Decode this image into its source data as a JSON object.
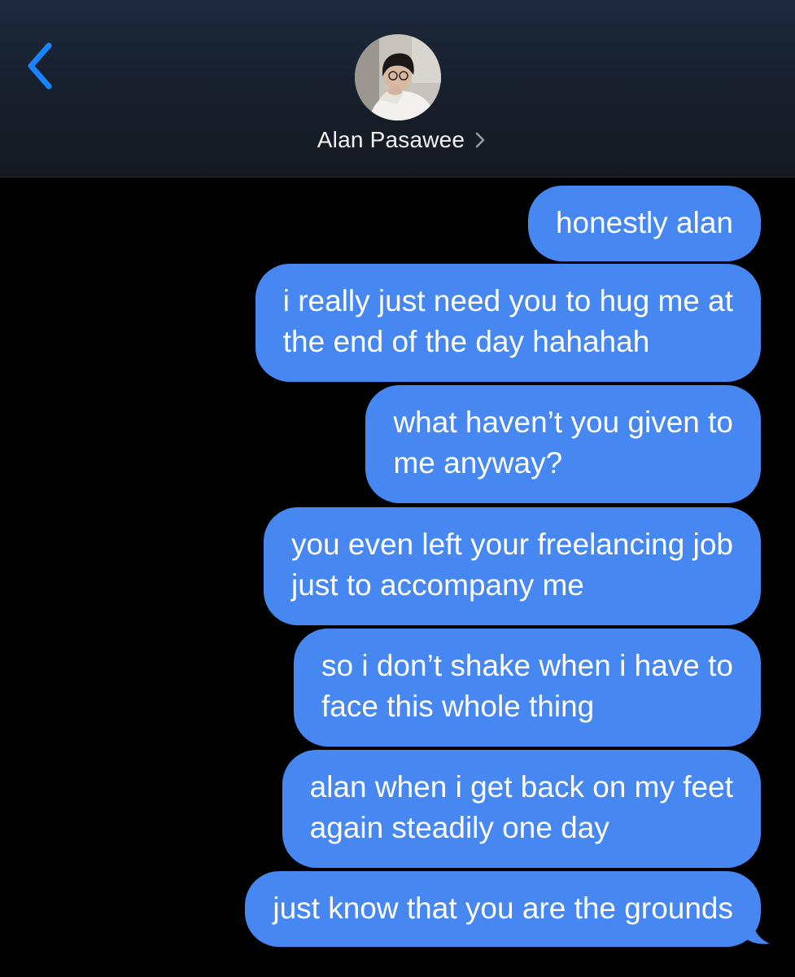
{
  "header": {
    "contact_name": "Alan Pasawee",
    "back_icon": "chevron-left-icon",
    "name_chevron_icon": "chevron-right-icon",
    "accent_color": "#1a84ff",
    "bubble_color": "#4687f1"
  },
  "messages": [
    {
      "lines": [
        "honestly alan"
      ]
    },
    {
      "lines": [
        "i really just need you to hug me at",
        "the end of the day hahahah"
      ]
    },
    {
      "lines": [
        "what haven’t you given to",
        "me anyway?"
      ]
    },
    {
      "lines": [
        "you even left your freelancing job",
        "just to accompany me"
      ]
    },
    {
      "lines": [
        "so i don’t shake when i have to",
        "face this whole thing"
      ]
    },
    {
      "lines": [
        "alan when i get back on my feet",
        "again steadily one day"
      ]
    },
    {
      "lines": [
        "just know that you are the grounds"
      ]
    }
  ]
}
